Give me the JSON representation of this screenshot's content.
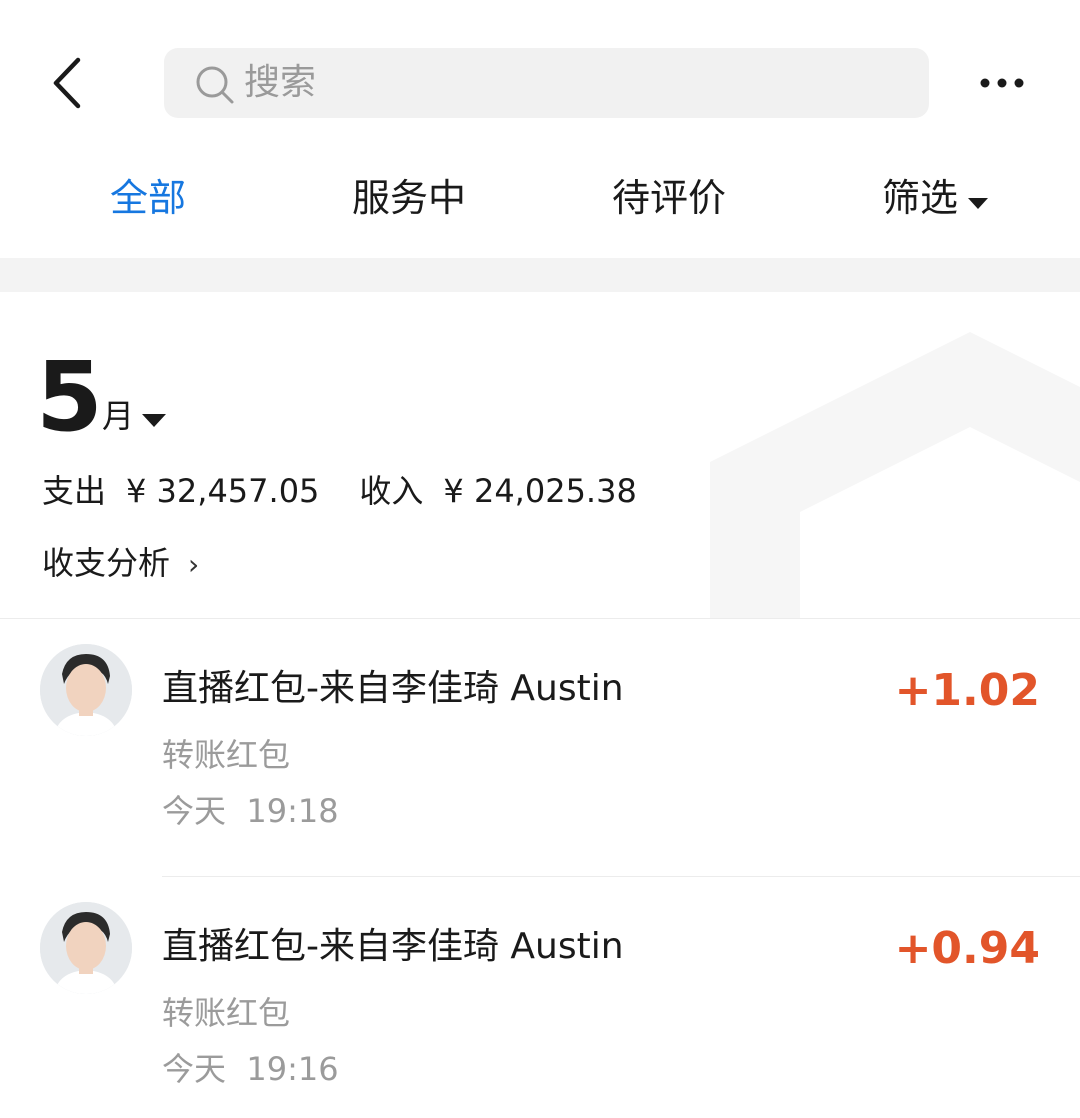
{
  "header": {
    "back_icon": "chevron-left-icon",
    "search_placeholder": "搜索",
    "search_icon": "search-icon",
    "more_icon": "more-horizontal-icon"
  },
  "tabs": [
    {
      "label": "全部",
      "active": true
    },
    {
      "label": "服务中",
      "active": false
    },
    {
      "label": "待评价",
      "active": false
    },
    {
      "label": "筛选",
      "active": false
    }
  ],
  "summary": {
    "month_number": "5",
    "month_unit": "月",
    "expense_label": "支出",
    "expense_value": "¥ 32,457.05",
    "income_label": "收入",
    "income_value": "¥ 24,025.38",
    "analysis_label": "收支分析"
  },
  "transactions": [
    {
      "title": "直播红包-来自李佳琦 Austin",
      "category": "转账红包",
      "day": "今天",
      "time": "19:18",
      "amount": "+1.02"
    },
    {
      "title": "直播红包-来自李佳琦 Austin",
      "category": "转账红包",
      "day": "今天",
      "time": "19:16",
      "amount": "+0.94"
    }
  ],
  "colors": {
    "accent_blue": "#1677e0",
    "income_orange": "#e2552a",
    "muted_gray": "#9b9b9b",
    "search_bg": "#f1f1f1"
  }
}
